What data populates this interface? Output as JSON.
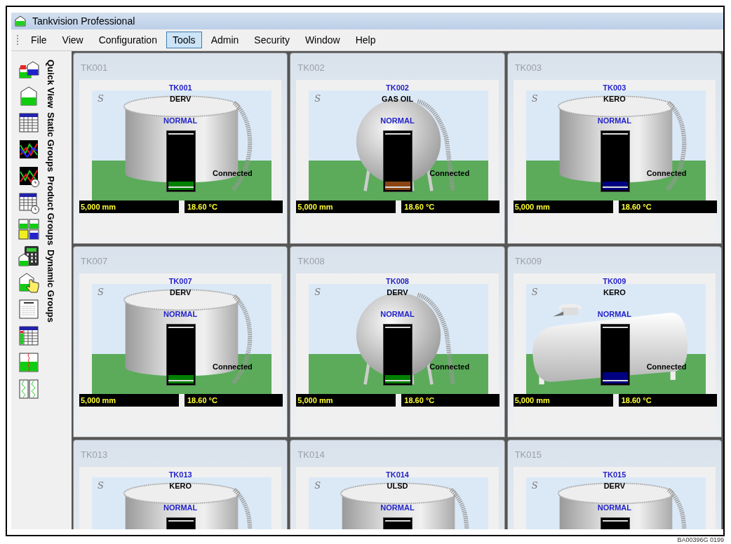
{
  "window": {
    "title": "Tankvision Professional"
  },
  "menu": [
    {
      "label": "File",
      "selected": false
    },
    {
      "label": "View",
      "selected": false
    },
    {
      "label": "Configuration",
      "selected": false
    },
    {
      "label": "Tools",
      "selected": true
    },
    {
      "label": "Admin",
      "selected": false
    },
    {
      "label": "Security",
      "selected": false
    },
    {
      "label": "Window",
      "selected": false
    },
    {
      "label": "Help",
      "selected": false
    }
  ],
  "side_tabs": [
    "Quick View",
    "Static Groups",
    "Product Groups",
    "Dynamic Groups"
  ],
  "tanks": [
    {
      "header": "TK001",
      "tag": "TK001",
      "product": "DERV",
      "mark": "S",
      "status": "NORMAL",
      "kind": "cylinder",
      "level": 0.15,
      "color": "#008000",
      "connection": "Connected",
      "level_reading": "5,000 mm",
      "temperature": "18.60 °C"
    },
    {
      "header": "TK002",
      "tag": "TK002",
      "product": "GAS OIL",
      "mark": "S",
      "status": "NORMAL",
      "kind": "sphere",
      "level": 0.15,
      "color": "#8b4513",
      "connection": "Connected",
      "level_reading": "5,000 mm",
      "temperature": "18.60 °C"
    },
    {
      "header": "TK003",
      "tag": "TK003",
      "product": "KERO",
      "mark": "S",
      "status": "NORMAL",
      "kind": "cylinder",
      "level": 0.15,
      "color": "#000080",
      "connection": "Connected",
      "level_reading": "5,000 mm",
      "temperature": "18.60 °C"
    },
    {
      "header": "TK007",
      "tag": "TK007",
      "product": "DERV",
      "mark": "S",
      "status": "NORMAL",
      "kind": "cylinder",
      "level": 0.15,
      "color": "#008000",
      "connection": "Connected",
      "level_reading": "5,000 mm",
      "temperature": "18.60 °C"
    },
    {
      "header": "TK008",
      "tag": "TK008",
      "product": "DERV",
      "mark": "S",
      "status": "NORMAL",
      "kind": "sphere",
      "level": 0.15,
      "color": "#008000",
      "connection": "Connected",
      "level_reading": "5,000 mm",
      "temperature": "18.60 °C"
    },
    {
      "header": "TK009",
      "tag": "TK009",
      "product": "KERO",
      "mark": "S",
      "status": "NORMAL",
      "kind": "horizontal",
      "level": 0.2,
      "color": "#000080",
      "connection": "Connected",
      "level_reading": "5,000 mm",
      "temperature": "18.60 °C"
    },
    {
      "header": "TK013",
      "tag": "TK013",
      "product": "KERO",
      "mark": "S",
      "status": "NORMAL",
      "kind": "cylinder"
    },
    {
      "header": "TK014",
      "tag": "TK014",
      "product": "ULSD",
      "mark": "S",
      "status": "NORMAL",
      "kind": "cylinder"
    },
    {
      "header": "TK015",
      "tag": "TK015",
      "product": "DERV",
      "mark": "S",
      "status": "NORMAL",
      "kind": "cylinder"
    }
  ],
  "figure_label": "BA00396G 0199"
}
